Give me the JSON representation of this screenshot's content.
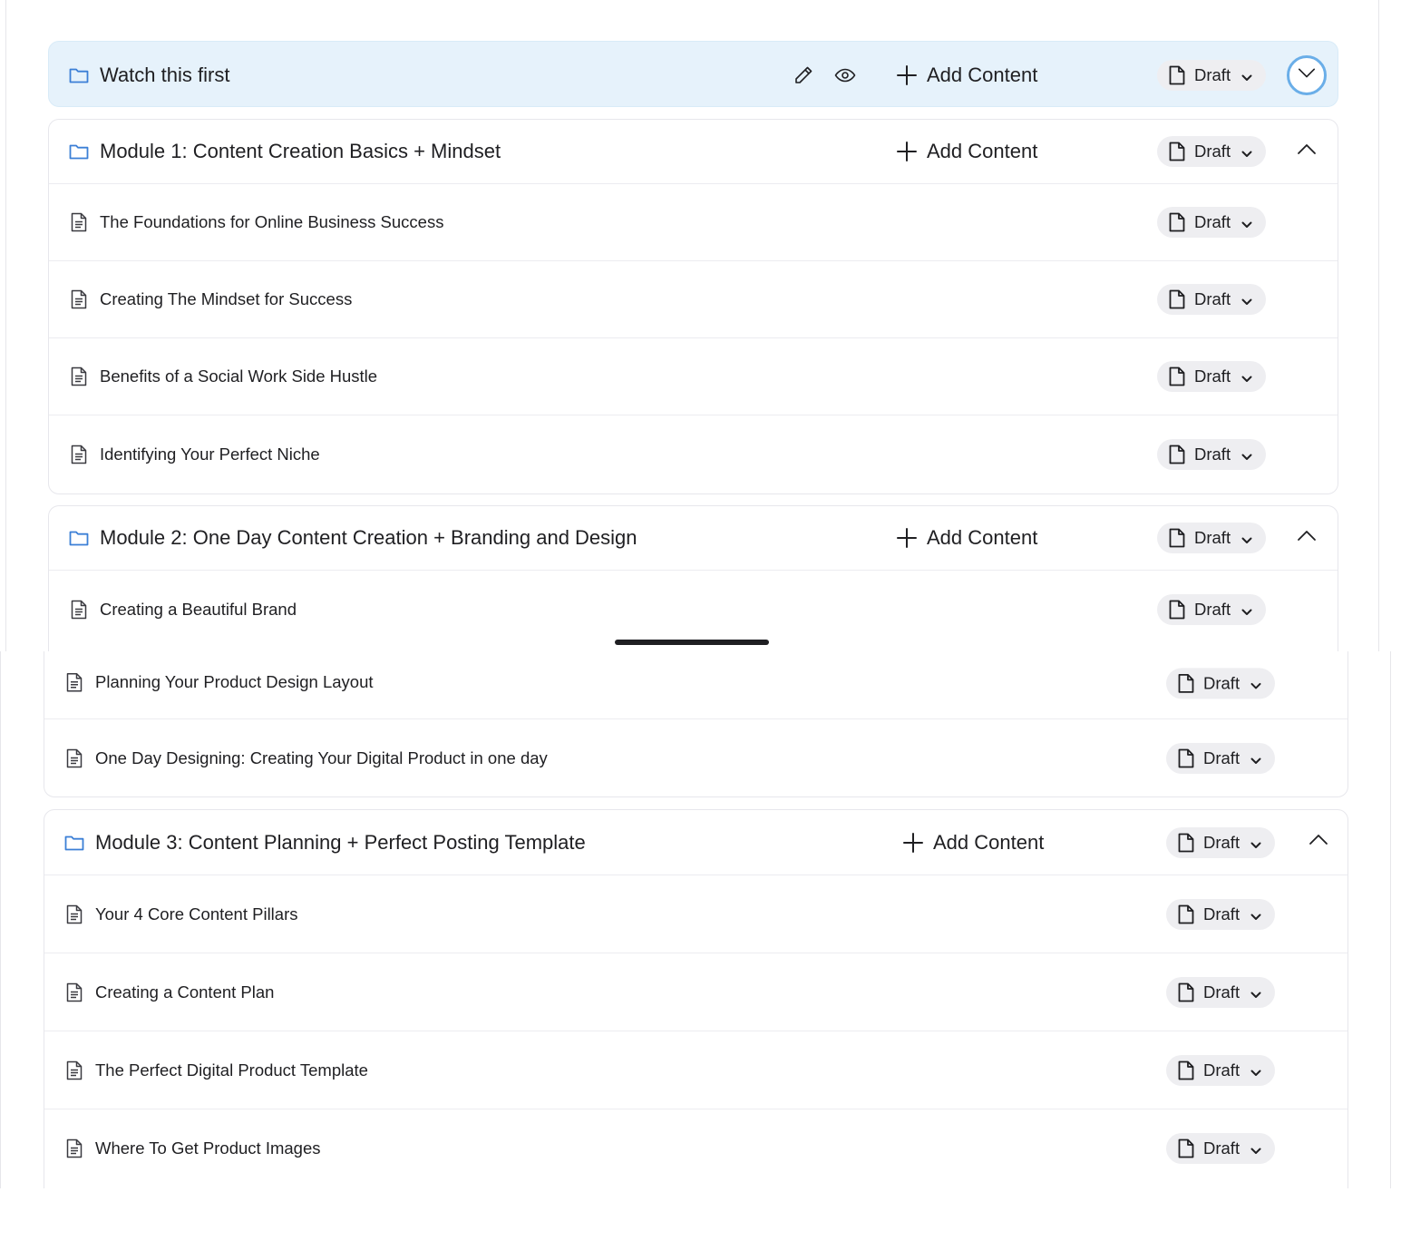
{
  "top_modules": [
    {
      "title": "Watch this first",
      "add_label": "Add Content",
      "status": "Draft",
      "lessons": []
    },
    {
      "title": "Module 1: Content Creation Basics + Mindset",
      "add_label": "Add Content",
      "status": "Draft",
      "lessons": [
        {
          "title": "The Foundations for Online Business Success",
          "status": "Draft"
        },
        {
          "title": "Creating The Mindset for Success",
          "status": "Draft"
        },
        {
          "title": "Benefits of a Social Work Side Hustle",
          "status": "Draft"
        },
        {
          "title": "Identifying Your Perfect Niche",
          "status": "Draft"
        }
      ]
    },
    {
      "title": "Module 2: One Day Content Creation + Branding and Design",
      "add_label": "Add Content",
      "status": "Draft",
      "lessons": [
        {
          "title": "Creating a Beautiful Brand",
          "status": "Draft"
        }
      ]
    }
  ],
  "bottom_module2_lessons": [
    {
      "title": "Planning Your Product Design Layout",
      "status": "Draft"
    },
    {
      "title": "One Day Designing: Creating Your Digital Product in one day",
      "status": "Draft"
    }
  ],
  "module3": {
    "title": "Module 3: Content Planning + Perfect Posting Template",
    "add_label": "Add Content",
    "status": "Draft",
    "lessons": [
      {
        "title": "Your 4 Core Content Pillars",
        "status": "Draft"
      },
      {
        "title": "Creating a Content Plan",
        "status": "Draft"
      },
      {
        "title": "The Perfect Digital Product Template",
        "status": "Draft"
      },
      {
        "title": "Where To Get Product Images",
        "status": "Draft"
      }
    ]
  },
  "colors": {
    "highlight_bg": "#e6f2fb",
    "focus_ring": "#6aaee8",
    "folder_icon": "#3b7fd6",
    "pill_bg": "#eeeef1"
  },
  "icons": {
    "folder": "folder-icon",
    "lesson": "document-icon",
    "add": "plus-icon",
    "status": "file-icon",
    "dropdown": "chevron-down-icon",
    "collapse": "chevron-up-icon",
    "expand": "chevron-down-circle-icon",
    "edit": "pencil-icon",
    "preview": "eye-icon"
  }
}
